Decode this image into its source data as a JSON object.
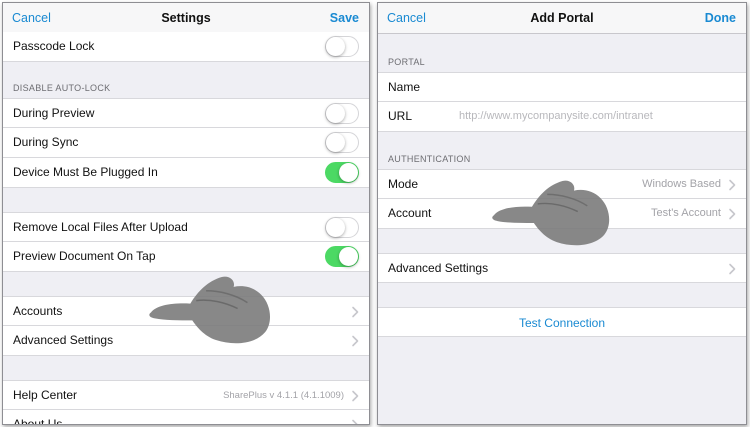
{
  "settings_panel": {
    "cancel_label": "Cancel",
    "title": "Settings",
    "save_label": "Save",
    "passcode_lock": {
      "label": "Passcode Lock",
      "enabled": false
    },
    "disable_autolock": {
      "header": "DISABLE AUTO-LOCK",
      "during_preview": {
        "label": "During Preview",
        "enabled": false
      },
      "during_sync": {
        "label": "During Sync",
        "enabled": false
      },
      "plugged_in": {
        "label": "Device Must Be Plugged In",
        "enabled": true
      }
    },
    "remove_files": {
      "label": "Remove Local Files After Upload",
      "enabled": false
    },
    "preview_on_tap": {
      "label": "Preview Document On Tap",
      "enabled": true
    },
    "accounts_label": "Accounts",
    "advanced_settings_label": "Advanced Settings",
    "help_center": {
      "label": "Help Center",
      "value": "SharePlus v 4.1.1 (4.1.1009)"
    },
    "about_us_label": "About Us"
  },
  "add_portal_panel": {
    "cancel_label": "Cancel",
    "title": "Add Portal",
    "done_label": "Done",
    "portal_header": "PORTAL",
    "name_label": "Name",
    "url_label": "URL",
    "url_placeholder": "http://www.mycompanysite.com/intranet",
    "auth_header": "AUTHENTICATION",
    "mode": {
      "label": "Mode",
      "value": "Windows Based"
    },
    "account": {
      "label": "Account",
      "value": "Test's Account"
    },
    "advanced_settings_label": "Advanced Settings",
    "test_connection_label": "Test Connection"
  },
  "colors": {
    "accent": "#1a8ad2",
    "toggle_on": "#4cd964",
    "grouped_background": "#efeff4"
  },
  "icons": [
    "chevron-right-icon",
    "hand-pointer-icon"
  ]
}
